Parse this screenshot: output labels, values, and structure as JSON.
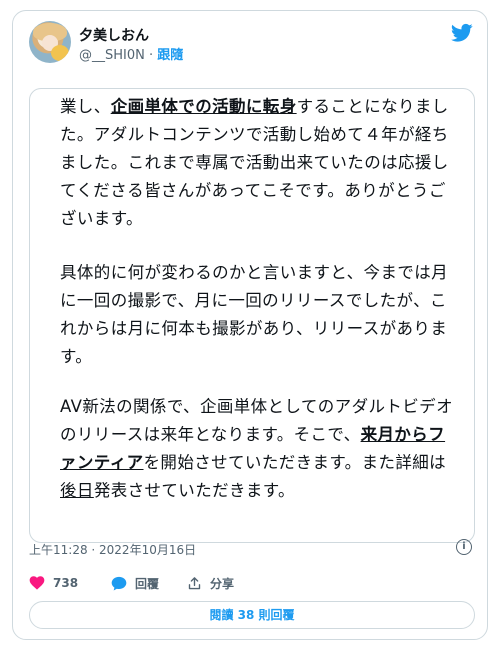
{
  "author": {
    "display_name": "夕美しおん",
    "handle": "@__SHI0N",
    "separator": "·",
    "follow_label": "跟隨"
  },
  "icons": {
    "logo": "twitter-bird-icon",
    "info": "info-icon",
    "like": "heart-icon",
    "reply": "speech-bubble-icon",
    "share": "share-icon"
  },
  "colors": {
    "accent": "#1d9bf0",
    "like": "#f91880",
    "border": "#cfd9de",
    "muted": "#536471"
  },
  "post": {
    "paragraphs": [
      [
        {
          "t": "業し、"
        },
        {
          "t": "企画単体での活動に転身",
          "hl": true
        },
        {
          "t": "することになりました。アダルトコンテンツで活動し始めて４年が経ちました。これまで専属で活動出来ていたのは応援してくださる皆さんがあってこそです。ありがとうございます。"
        }
      ],
      [
        {
          "t": "具体的に何が変わるのかと言いますと、今までは月に一回の撮影で、月に一回のリリースでしたが、これからは月に何本も撮影があり、リリースがあります。"
        }
      ],
      [
        {
          "t": "AV新法の関係で、企画単体としてのアダルトビデオのリリースは来年となります。そこで、"
        },
        {
          "t": "来月からファンティア",
          "hl": true
        },
        {
          "t": "を開始させていただきます。また詳細は"
        },
        {
          "t": "後日",
          "ul": true
        },
        {
          "t": "発表させていただきます。"
        }
      ]
    ],
    "timestamp": "上午11:28 · 2022年10月16日"
  },
  "actions": {
    "likes": "738",
    "reply_label": "回覆",
    "share_label": "分享"
  },
  "read_replies_label": "閱讀 38 則回覆"
}
